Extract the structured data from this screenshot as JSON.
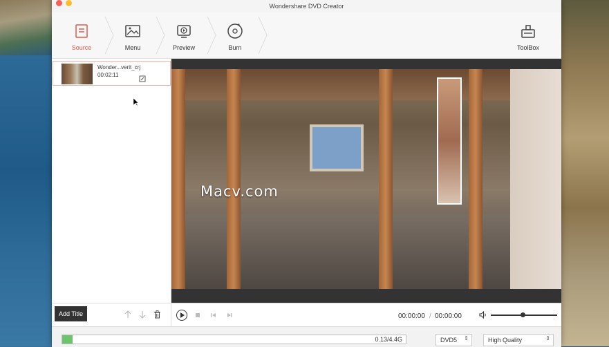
{
  "window": {
    "title": "Wondershare DVD Creator"
  },
  "toolbar": {
    "steps": [
      {
        "label": "Source",
        "icon": "source-icon",
        "active": true
      },
      {
        "label": "Menu",
        "icon": "menu-icon",
        "active": false
      },
      {
        "label": "Preview",
        "icon": "preview-icon",
        "active": false
      },
      {
        "label": "Burn",
        "icon": "burn-icon",
        "active": false
      }
    ],
    "toolbox_label": "ToolBox"
  },
  "title_list": [
    {
      "name": "Wonder...verit_crj",
      "duration": "00:02:11"
    }
  ],
  "preview": {
    "watermark": "Macv.com"
  },
  "title_controls": {
    "add_title_label": "Add Title"
  },
  "player": {
    "current_time": "00:00:00",
    "separator": "/",
    "total_time": "00:00:00",
    "volume_level": 0.48
  },
  "status": {
    "usage_text": "0.13/4.4G",
    "usage_fraction": 0.03,
    "disc_type": "DVD5",
    "quality": "High Quality"
  },
  "colors": {
    "accent": "#e05a49",
    "progress": "#6ec46d"
  }
}
